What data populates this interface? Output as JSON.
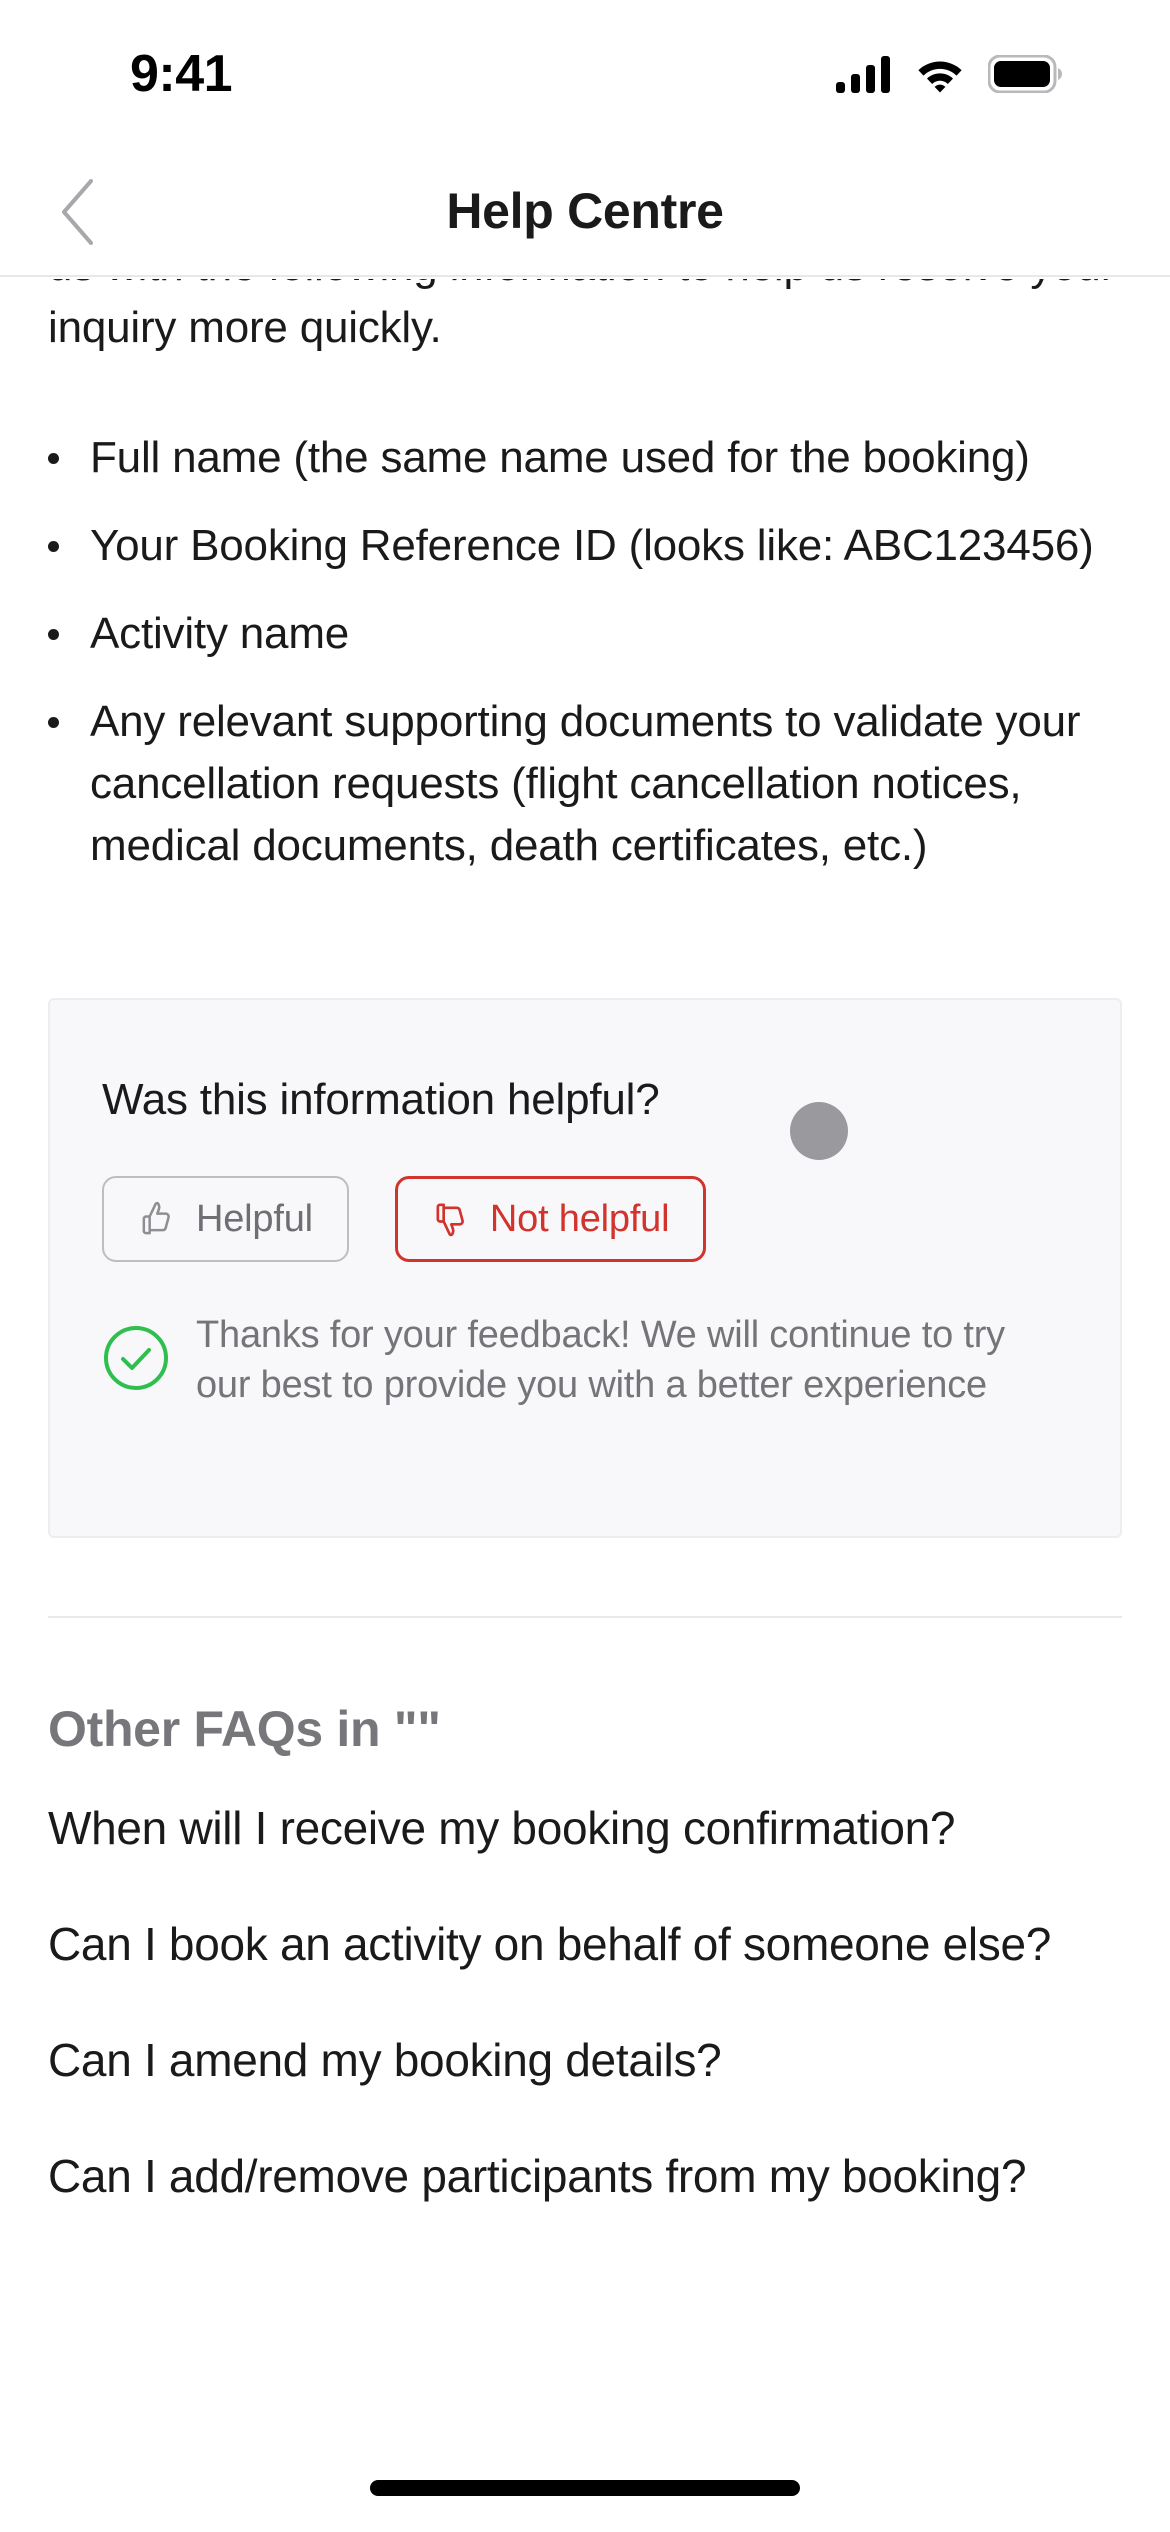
{
  "status_bar": {
    "time": "9:41",
    "cellular_icon": "cellular-signal-icon",
    "wifi_icon": "wifi-icon",
    "battery_icon": "battery-full-icon"
  },
  "nav": {
    "back_icon": "chevron-left-icon",
    "title": "Help Centre"
  },
  "article": {
    "intro_clipped": "us with the following information to help us resolve your inquiry more quickly.",
    "bullets": [
      "Full name (the same name used for the booking)",
      "Your Booking Reference ID (looks like: ABC123456)",
      "Activity name",
      "Any relevant supporting documents to validate your cancellation requests (flight cancellation notices, medical documents, death certificates, etc.)"
    ]
  },
  "feedback": {
    "question": "Was this information helpful?",
    "helpful_label": "Helpful",
    "helpful_icon": "thumbs-up-icon",
    "not_helpful_label": "Not helpful",
    "not_helpful_icon": "thumbs-down-icon",
    "thanks_icon": "check-circle-icon",
    "thanks_message": "Thanks for your feedback! We will continue to try our best to provide you with a better experience",
    "touch_indicator": "touch-pointer-dot"
  },
  "other_faqs": {
    "heading": "Other FAQs in \"\"",
    "items": [
      "When will I receive my booking confirmation?",
      "Can I book an activity on behalf of someone else?",
      "Can I amend my booking details?",
      "Can I add/remove participants from my booking?"
    ]
  },
  "colors": {
    "accent_red": "#d0342c",
    "success_green": "#2fbf4e",
    "muted_text": "#757579",
    "card_bg": "#f8f8fa",
    "body_text": "#1a1a1a"
  },
  "home_indicator": "home-indicator-bar"
}
